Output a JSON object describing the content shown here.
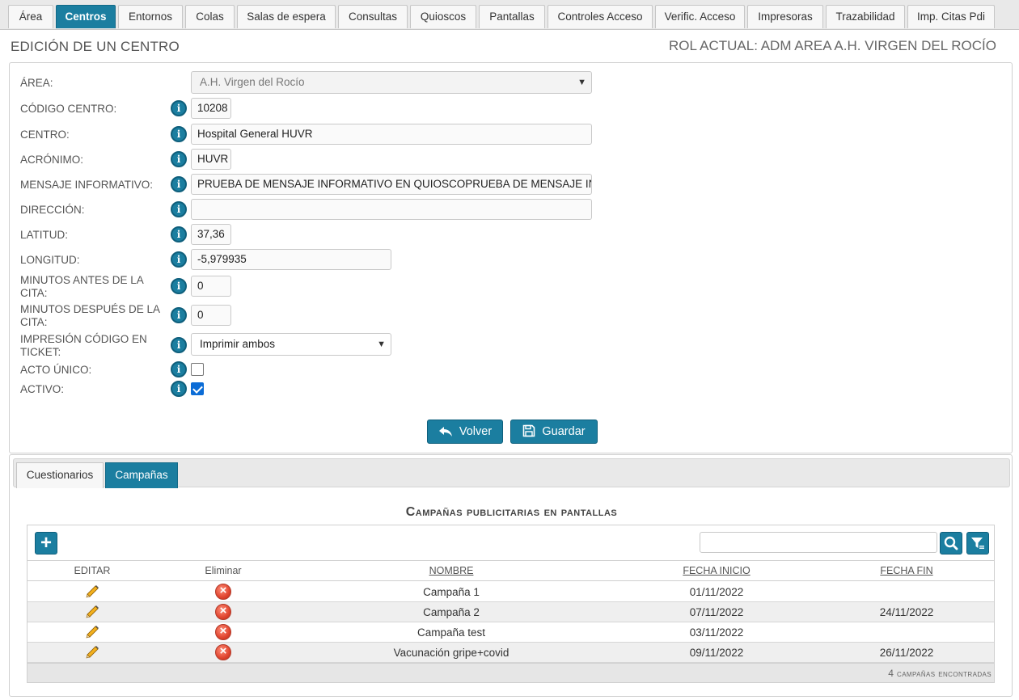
{
  "nav": {
    "tabs": [
      {
        "label": "Área",
        "active": false
      },
      {
        "label": "Centros",
        "active": true
      },
      {
        "label": "Entornos",
        "active": false
      },
      {
        "label": "Colas",
        "active": false
      },
      {
        "label": "Salas de espera",
        "active": false
      },
      {
        "label": "Consultas",
        "active": false
      },
      {
        "label": "Quioscos",
        "active": false
      },
      {
        "label": "Pantallas",
        "active": false
      },
      {
        "label": "Controles Acceso",
        "active": false
      },
      {
        "label": "Verific. Acceso",
        "active": false
      },
      {
        "label": "Impresoras",
        "active": false
      },
      {
        "label": "Trazabilidad",
        "active": false
      },
      {
        "label": "Imp. Citas Pdi",
        "active": false
      }
    ]
  },
  "header": {
    "title": "EDICIÓN DE UN CENTRO",
    "role": "ROL ACTUAL: ADM AREA A.H. VIRGEN DEL ROCÍO"
  },
  "form": {
    "area": {
      "label": "ÁREA:",
      "value": "A.H. Virgen del Rocío"
    },
    "codigo": {
      "label": "CÓDIGO CENTRO:",
      "value": "10208"
    },
    "centro": {
      "label": "CENTRO:",
      "value": "Hospital General HUVR"
    },
    "acronimo": {
      "label": "ACRÓNIMO:",
      "value": "HUVR"
    },
    "mensaje": {
      "label": "MENSAJE INFORMATIVO:",
      "value": "PRUEBA DE MENSAJE INFORMATIVO EN QUIOSCOPRUEBA DE MENSAJE INFORMATIVO"
    },
    "direccion": {
      "label": "DIRECCIÓN:",
      "value": ""
    },
    "latitud": {
      "label": "LATITUD:",
      "value": "37,36"
    },
    "longitud": {
      "label": "LONGITUD:",
      "value": "-5,979935"
    },
    "min_antes": {
      "label": "MINUTOS ANTES DE LA CITA:",
      "value": "0"
    },
    "min_despues": {
      "label": "MINUTOS DESPUÉS DE LA CITA:",
      "value": "0"
    },
    "impresion": {
      "label": "IMPRESIÓN CÓDIGO EN TICKET:",
      "value": "Imprimir ambos"
    },
    "acto_unico": {
      "label": "ACTO ÚNICO:",
      "checked": false
    },
    "activo": {
      "label": "ACTIVO:",
      "checked": true
    },
    "volver_label": "Volver",
    "guardar_label": "Guardar"
  },
  "subtabs": {
    "items": [
      {
        "label": "Cuestionarios",
        "active": false
      },
      {
        "label": "Campañas",
        "active": true
      }
    ]
  },
  "grid": {
    "title": "Campañas publicitarias en pantallas",
    "headers": {
      "editar": "EDITAR",
      "eliminar": "Eliminar",
      "nombre": "NOMBRE",
      "fecha_inicio": "FECHA INICIO",
      "fecha_fin": "FECHA FIN"
    },
    "rows": [
      {
        "nombre": "Campaña 1",
        "fecha_inicio": "01/11/2022",
        "fecha_fin": ""
      },
      {
        "nombre": "Campaña 2",
        "fecha_inicio": "07/11/2022",
        "fecha_fin": "24/11/2022"
      },
      {
        "nombre": "Campaña test",
        "fecha_inicio": "03/11/2022",
        "fecha_fin": ""
      },
      {
        "nombre": "Vacunación gripe+covid",
        "fecha_inicio": "09/11/2022",
        "fecha_fin": "26/11/2022"
      }
    ],
    "count_text": "4 campañas encontradas",
    "search_value": ""
  },
  "colors": {
    "accent": "#1b7ea0",
    "delete": "#e0452f",
    "checkbox": "#0b6cd6"
  }
}
